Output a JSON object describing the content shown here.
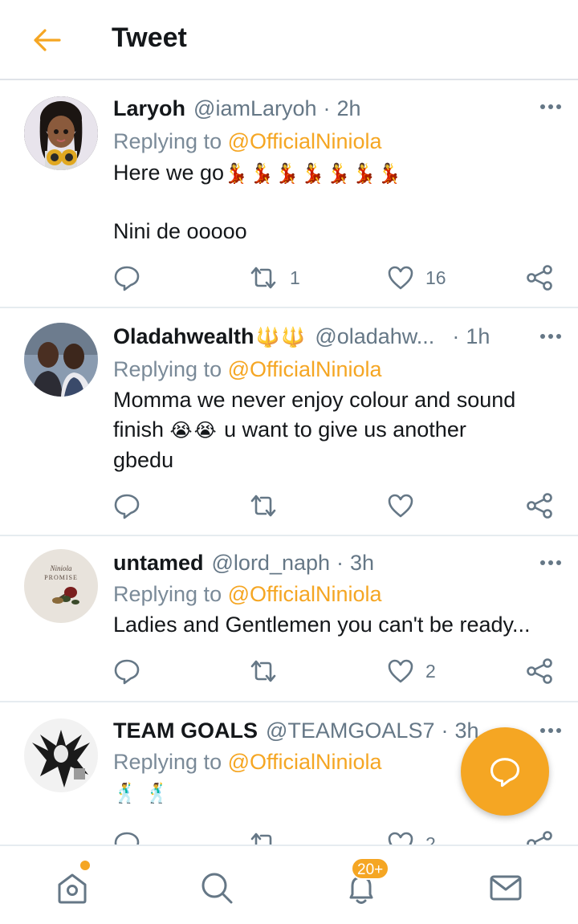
{
  "header": {
    "title": "Tweet"
  },
  "tweets": [
    {
      "name": "Laryoh",
      "handle": "@iamLaryoh",
      "time": "2h",
      "replying_prefix": "Replying to ",
      "replying_to": "@OfficialNiniola",
      "line1": "Here we go",
      "line1_emoji": "💃💃💃💃💃💃💃",
      "line2": "Nini de ooooo",
      "retweets": "1",
      "likes": "16"
    },
    {
      "name": "Oladahwealth",
      "name_emoji": "🔱🔱",
      "handle": "@oladahw...",
      "time": "1h",
      "replying_prefix": "Replying to ",
      "replying_to": "@OfficialNiniola",
      "line1": "Momma we never enjoy colour and sound",
      "line2a": "finish ",
      "line2_emoji": "😭😭",
      "line2b": " u want to give us another",
      "line3": "gbedu"
    },
    {
      "name": "untamed",
      "handle": "@lord_naph",
      "time": "3h",
      "avatar_text_1": "Niniola",
      "avatar_text_2": "PROMISE",
      "replying_prefix": "Replying to ",
      "replying_to": "@OfficialNiniola",
      "line1": "Ladies and Gentlemen you can't be ready...",
      "likes": "2"
    },
    {
      "name": "TEAM GOALS",
      "handle": "@TEAMGOALS7",
      "time": "3h",
      "replying_prefix": "Replying to ",
      "replying_to": "@OfficialNiniola",
      "line1_emoji": "🕺🕺",
      "likes": "2"
    }
  ],
  "nav": {
    "notifications_badge": "20+"
  },
  "colors": {
    "accent": "#f5a623",
    "muted": "#657786",
    "divider": "#e6ecf0",
    "icon": "#657786"
  },
  "icons": [
    "back-arrow-icon",
    "more-icon",
    "reply-icon",
    "retweet-icon",
    "like-icon",
    "share-icon",
    "compose-reply-icon",
    "home-icon",
    "search-icon",
    "notifications-icon",
    "messages-icon"
  ]
}
